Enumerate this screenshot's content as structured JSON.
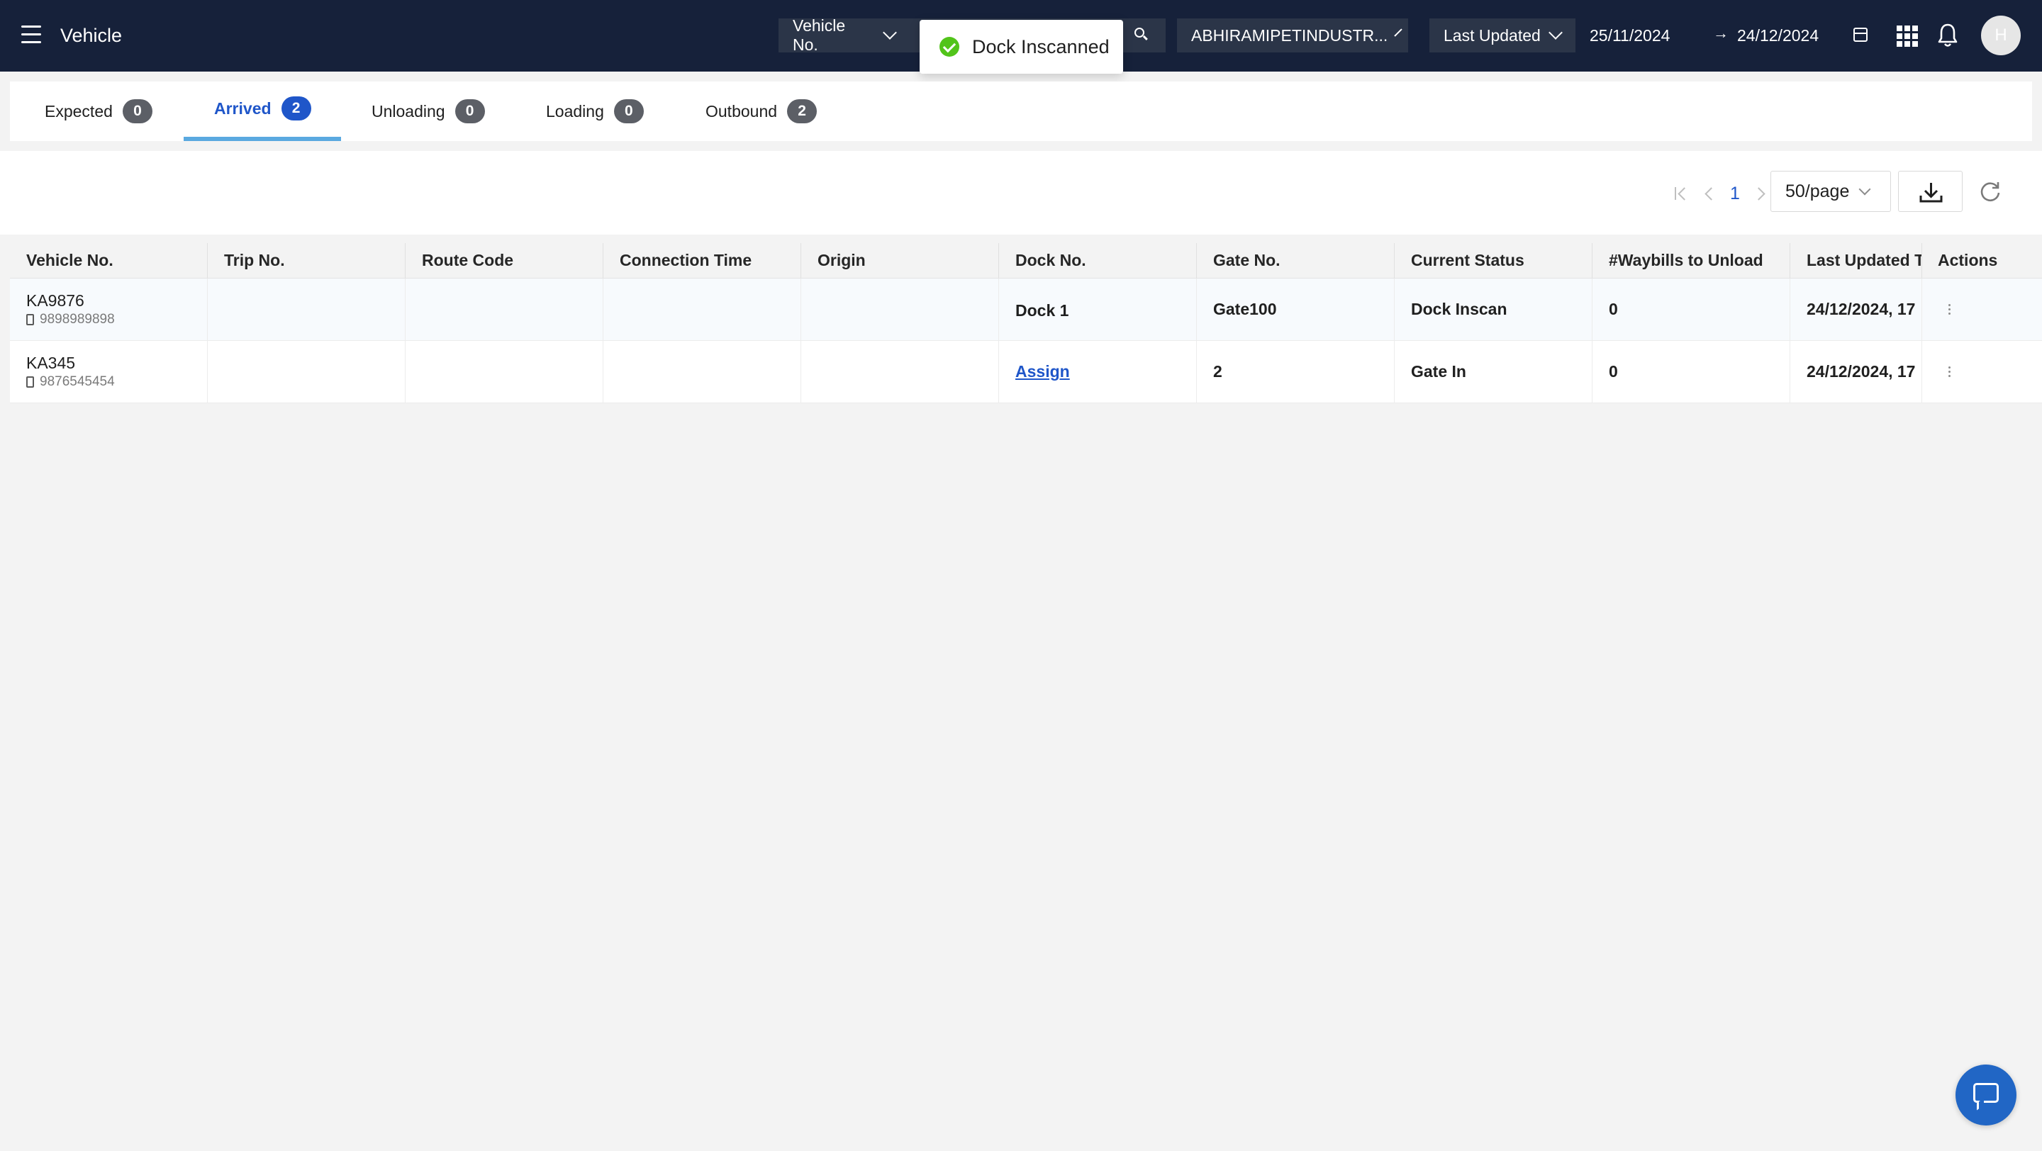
{
  "header": {
    "title": "Vehicle",
    "search_type": "Vehicle No.",
    "location": "ABHIRAMIPETINDUSTR...",
    "date_filter": "Last Updated",
    "date_from": "25/11/2024",
    "date_arrow": "→",
    "date_to": "24/12/2024",
    "avatar_initial": "H"
  },
  "toast": {
    "message": "Dock Inscanned"
  },
  "tabs": [
    {
      "label": "Expected",
      "count": "0"
    },
    {
      "label": "Arrived",
      "count": "2"
    },
    {
      "label": "Unloading",
      "count": "0"
    },
    {
      "label": "Loading",
      "count": "0"
    },
    {
      "label": "Outbound",
      "count": "2"
    }
  ],
  "active_tab": "Arrived",
  "pagination": {
    "current_page": "1",
    "page_size": "50/page"
  },
  "table": {
    "columns": [
      "Vehicle No.",
      "Trip No.",
      "Route Code",
      "Connection Time",
      "Origin",
      "Dock No.",
      "Gate No.",
      "Current Status",
      "#Waybills to Unload",
      "Last Updated Time",
      "Actions"
    ],
    "rows": [
      {
        "vehicle_no": "KA9876",
        "phone": "9898989898",
        "trip_no": "",
        "route_code": "",
        "connection_time": "",
        "origin": "",
        "dock_no": "Dock 1",
        "gate_no": "Gate100",
        "current_status": "Dock Inscan",
        "waybills": "0",
        "last_updated": "24/12/2024, 17"
      },
      {
        "vehicle_no": "KA345",
        "phone": "9876545454",
        "trip_no": "",
        "route_code": "",
        "connection_time": "",
        "origin": "",
        "dock_no": "Assign",
        "gate_no": "2",
        "current_status": "Gate In",
        "waybills": "0",
        "last_updated": "24/12/2024, 17"
      }
    ]
  },
  "colors": {
    "topbar_bg": "#16213a",
    "accent": "#1f56c9",
    "tab_underline": "#5aa9e0",
    "success": "#52c41a",
    "chat_button": "#2166c5"
  },
  "icons": {
    "menu": "hamburger-icon",
    "search": "search-icon",
    "calendar": "calendar-icon",
    "apps": "apps-grid-icon",
    "notifications": "bell-icon",
    "toast": "check-circle-icon",
    "download": "download-icon",
    "refresh": "refresh-icon",
    "phone": "phone-icon",
    "row_actions": "more-vertical-icon",
    "chat": "chat-icon"
  }
}
